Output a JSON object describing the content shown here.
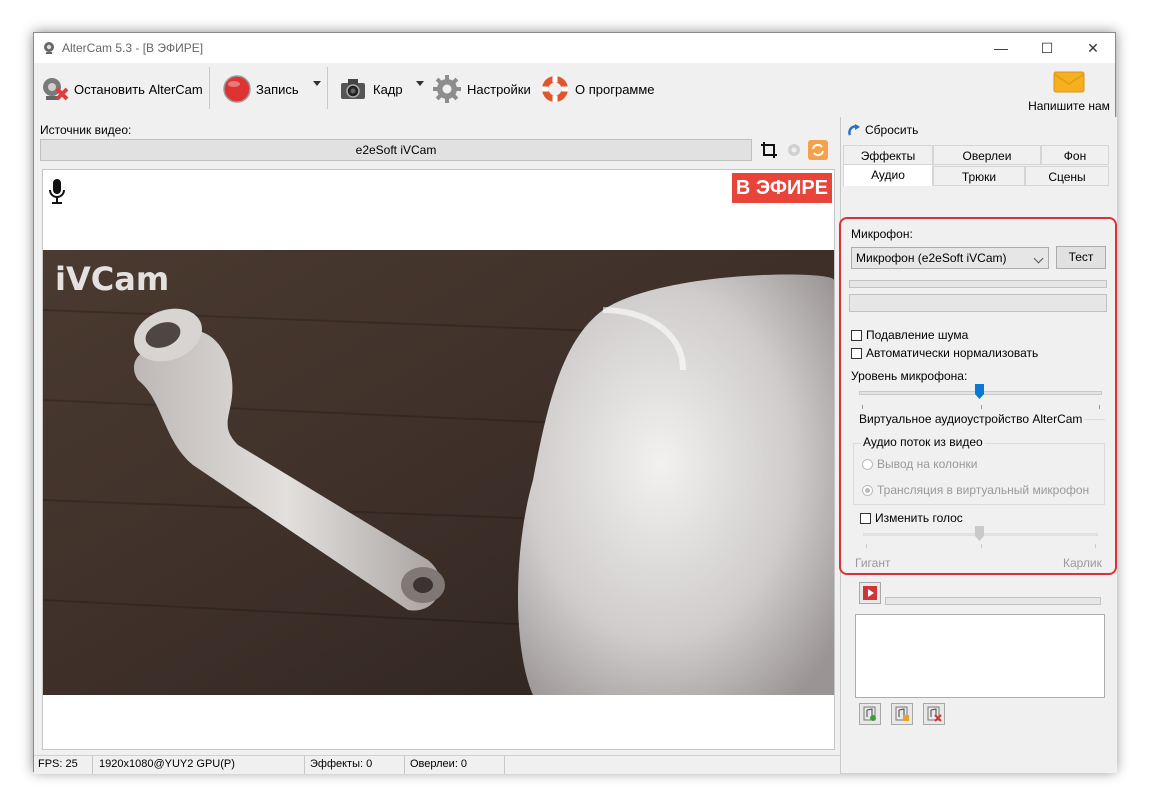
{
  "window": {
    "title": "AlterCam 5.3 - [В ЭФИРЕ]",
    "controls": {
      "minimize": "—",
      "maximize": "☐",
      "close": "✕"
    }
  },
  "toolbar": {
    "stop_label": "Остановить AlterCam",
    "record_label": "Запись",
    "frame_label": "Кадр",
    "settings_label": "Настройки",
    "about_label": "О программе",
    "write_us_label": "Напишите нам"
  },
  "source": {
    "label": "Источник видео:",
    "value": "e2eSoft iVCam"
  },
  "preview": {
    "onair_label": "В ЭФИРЕ",
    "watermark": "iVCam"
  },
  "statusbar": {
    "fps": "FPS: 25",
    "format": "1920x1080@YUY2 GPU(P)",
    "effects": "Эффекты: 0",
    "overlays": "Оверлеи: 0"
  },
  "right": {
    "reset_label": "Сбросить",
    "tabs_row1": [
      "Эффекты",
      "Оверлеи",
      "Фон"
    ],
    "tabs_row2": [
      "Аудио",
      "Трюки",
      "Сцены"
    ],
    "active_tab": "Аудио"
  },
  "audio": {
    "mic_label": "Микрофон:",
    "mic_value": "Микрофон (e2eSoft iVCam)",
    "test_label": "Тест",
    "noise_label": "Подавление шума",
    "noise_checked": false,
    "normalize_label": "Автоматически нормализовать",
    "normalize_checked": false,
    "level_label": "Уровень микрофона:",
    "level_value": 0.5,
    "virtual_group_label": "Виртуальное аудиоустройство AlterCam",
    "stream_group_label": "Аудио поток из видео",
    "radio_speakers": "Вывод на колонки",
    "radio_virtual": "Трансляция в виртуальный микрофон",
    "selected_radio": "radio_virtual",
    "voice_label": "Изменить голос",
    "voice_checked": false,
    "voice_value": 0.5,
    "voice_min_label": "Гигант",
    "voice_max_label": "Карлик"
  },
  "colors": {
    "accent_red": "#d8333a",
    "onair_bg": "#e8443a",
    "window_bg": "#f0f0f0"
  }
}
